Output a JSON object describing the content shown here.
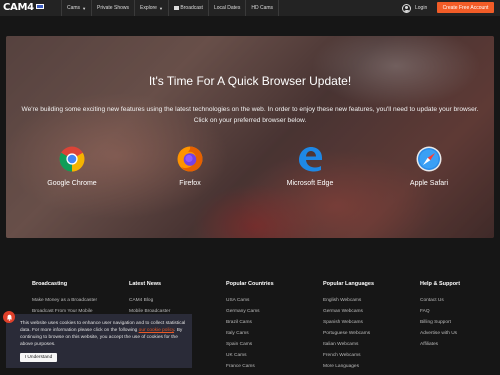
{
  "header": {
    "logo": {
      "cam": "CAM",
      "four": "4"
    },
    "nav": [
      {
        "label": "Cams",
        "caret": true
      },
      {
        "label": "Private Shows",
        "caret": false
      },
      {
        "label": "Explore",
        "caret": true
      },
      {
        "label": "Broadcast",
        "caret": false,
        "icon": "camera-icon"
      },
      {
        "label": "Local Dates",
        "caret": false
      },
      {
        "label": "HD Cams",
        "caret": false
      }
    ],
    "login_label": "Login",
    "create_account_label": "Create Free Account"
  },
  "hero": {
    "title": "It's Time For A Quick Browser Update!",
    "text": "We're building some exciting new features using the latest technologies on the web. In order to enjoy these new features, you'll need to update your browser. Click on your preferred browser below.",
    "browsers": [
      {
        "name": "Google Chrome",
        "icon": "chrome-icon"
      },
      {
        "name": "Firefox",
        "icon": "firefox-icon"
      },
      {
        "name": "Microsoft Edge",
        "icon": "edge-icon"
      },
      {
        "name": "Apple Safari",
        "icon": "safari-icon"
      }
    ]
  },
  "footer": {
    "columns": [
      {
        "heading": "Broadcasting",
        "links": [
          "Make Money as a Broadcaster",
          "Broadcast From Your Mobile"
        ]
      },
      {
        "heading": "Latest News",
        "links": [
          "CAM4 Blog",
          "Mobile Broadcaster"
        ]
      },
      {
        "heading": "Popular Countries",
        "links": [
          "USA Cams",
          "Germany Cams",
          "Brazil Cams",
          "Italy Cams",
          "Spain Cams",
          "UK Cams",
          "France Cams"
        ]
      },
      {
        "heading": "Popular Languages",
        "links": [
          "English Webcams",
          "German Webcams",
          "Spanish Webcams",
          "Portuguese Webcams",
          "Italian Webcams",
          "French Webcams",
          "More Languages"
        ]
      },
      {
        "heading": "Help & Support",
        "links": [
          "Contact Us",
          "FAQ",
          "Billing Support",
          "Advertise with Us",
          "Affiliates"
        ]
      }
    ]
  },
  "cookie": {
    "text_before": "This website uses cookies to enhance user navigation and to collect statistical data. For more information please click on the following ",
    "link": "our cookie policy",
    "text_after": ". By continuing to browse on this website, you accept the use of cookies for the above purposes.",
    "button": "I Understand"
  },
  "colors": {
    "accent": "#f25c27",
    "header_bg": "#232323",
    "footer_bg": "#161616",
    "cookie_bg": "#2b2c3a"
  }
}
